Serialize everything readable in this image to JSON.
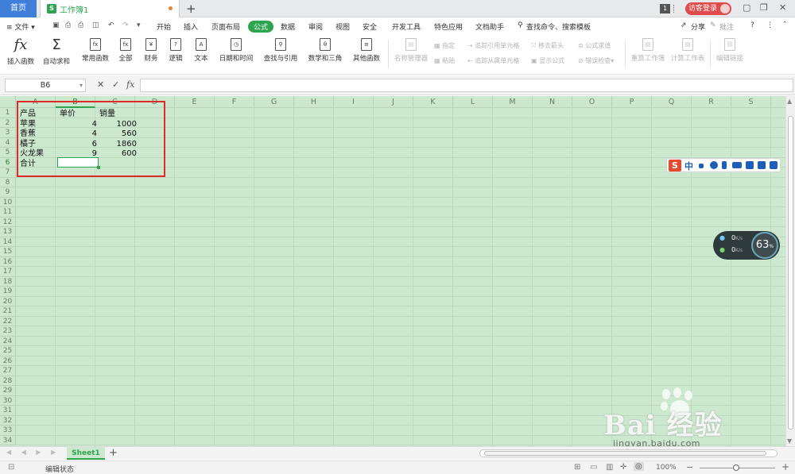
{
  "titlebar": {
    "home_tab": "首页",
    "doc_tab": "工作簿1",
    "doc_icon": "S",
    "new_tab": "+",
    "page_badge": "1",
    "visitor_login": "访客登录",
    "min_icon": "▢",
    "restore_icon": "❐",
    "close_icon": "✕"
  },
  "menubar": {
    "file": "≡ 文件 ▾",
    "tabs": [
      "开始",
      "插入",
      "页面布局",
      "公式",
      "数据",
      "审阅",
      "视图",
      "安全",
      "开发工具",
      "特色应用",
      "文档助手"
    ],
    "active_tab": "公式",
    "search": "查找命令、搜索模板",
    "share": "分享",
    "annotate": "批注",
    "help": "?",
    "more": "⋮"
  },
  "ribbon": {
    "insert_function": "插入函数",
    "autosum": "自动求和",
    "common_functions": "常用函数",
    "all": "全部",
    "financial": "财务",
    "logical": "逻辑",
    "text": "文本",
    "datetime": "日期和时间",
    "lookup": "查找与引用",
    "math": "数学和三角",
    "other": "其他函数",
    "name_manager": "名称管理器",
    "define": "指定",
    "paste": "粘贴",
    "trace_precedents": "追踪引用单元格",
    "trace_dependents": "追踪从属单元格",
    "remove_arrows": "移去箭头",
    "show_formulas": "显示公式",
    "evaluate": "公式求值",
    "error_check": "错误检查",
    "recalc_workbook": "重算工作簿",
    "calc_sheet": "计算工作表",
    "edit_links": "编辑链接"
  },
  "formula_bar": {
    "name_box": "B6",
    "cancel": "✕",
    "confirm": "✓",
    "fx": "fx",
    "formula": ""
  },
  "grid": {
    "columns": [
      "A",
      "B",
      "C",
      "D",
      "E",
      "F",
      "G",
      "H",
      "I",
      "J",
      "K",
      "L",
      "M",
      "N",
      "O",
      "P",
      "Q",
      "R",
      "S"
    ],
    "rows": [
      "1",
      "2",
      "3",
      "4",
      "5",
      "6",
      "7",
      "8",
      "9",
      "10",
      "11",
      "12",
      "13",
      "14",
      "15",
      "16",
      "17",
      "18",
      "19",
      "20",
      "21",
      "22",
      "23",
      "24",
      "25",
      "26",
      "27",
      "28",
      "29",
      "30",
      "31",
      "32",
      "33",
      "34"
    ],
    "selected_cell": "B6",
    "headers": {
      "A1": "产品",
      "B1": "单价",
      "C1": "销量"
    },
    "data": [
      {
        "product": "苹果",
        "price": "4",
        "qty": "1000"
      },
      {
        "product": "香蕉",
        "price": "4",
        "qty": "560"
      },
      {
        "product": "橘子",
        "price": "6",
        "qty": "1860"
      },
      {
        "product": "火龙果",
        "price": "9",
        "qty": "600"
      }
    ],
    "total_label": "合计"
  },
  "sheetbar": {
    "nav": "◀ ◀ ▶ ▶",
    "sheet1": "Sheet1",
    "add": "+"
  },
  "statusbar": {
    "mode": "编辑状态",
    "zoom": "100%"
  },
  "ime": {
    "logo": "S",
    "lang": "中"
  },
  "netmon": {
    "up": "0",
    "down": "0",
    "unit": "K/s",
    "percent": "63",
    "percent_unit": "%"
  },
  "watermark": {
    "brand": "Bai  经验",
    "url": "jingyan.baidu.com"
  },
  "colors": {
    "accent": "#2ea44f",
    "grid_bg": "#cce8cf",
    "highlight_box": "#e02a2a",
    "home_tab": "#3f7fd8"
  }
}
